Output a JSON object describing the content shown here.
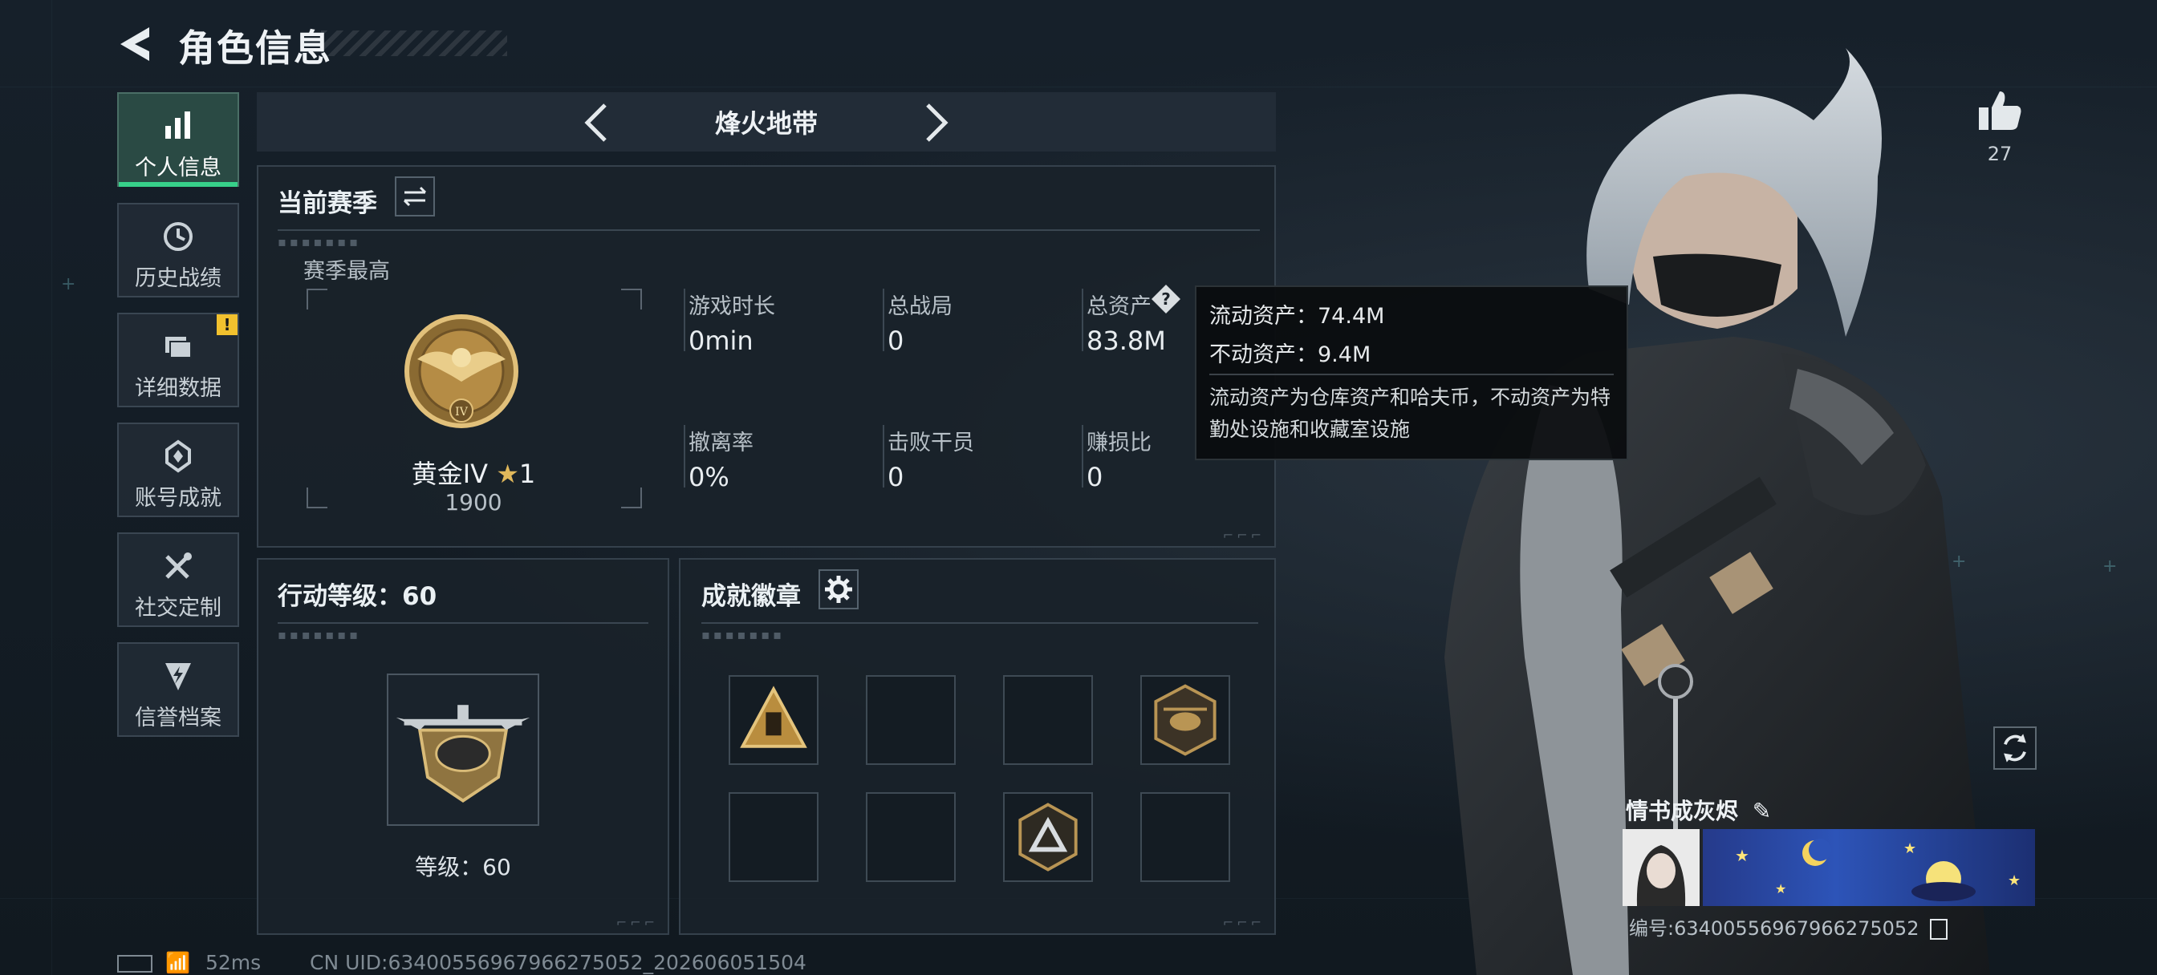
{
  "header": {
    "title": "角色信息",
    "back_icon": "back-arrow-icon"
  },
  "sidebar": {
    "items": [
      {
        "label": "个人信息",
        "icon": "bar-chart-icon",
        "active": true
      },
      {
        "label": "历史战绩",
        "icon": "history-clock-icon"
      },
      {
        "label": "详细数据",
        "icon": "folder-icon",
        "badge": "!"
      },
      {
        "label": "账号成就",
        "icon": "achievement-icon"
      },
      {
        "label": "社交定制",
        "icon": "tools-icon"
      },
      {
        "label": "信誉档案",
        "icon": "shield-bolt-icon"
      }
    ]
  },
  "map_selector": {
    "name": "烽火地带"
  },
  "season": {
    "title": "当前赛季",
    "peak_label": "赛季最高",
    "rank_name": "黄金IV",
    "rank_stars": "1",
    "rank_points": "1900",
    "stats": [
      {
        "label": "游戏时长",
        "value": "0min"
      },
      {
        "label": "总战局",
        "value": "0"
      },
      {
        "label": "总资产",
        "value": "83.8M"
      },
      {
        "label": "撤离率",
        "value": "0%"
      },
      {
        "label": "击败干员",
        "value": "0"
      },
      {
        "label": "赚损比",
        "value": "0"
      }
    ]
  },
  "tooltip": {
    "liquid": "流动资产：74.4M",
    "fixed": "不动资产：9.4M",
    "desc": "流动资产为仓库资产和哈夫币，不动资产为特勤处设施和收藏室设施"
  },
  "level": {
    "title": "行动等级：60",
    "caption": "等级：60"
  },
  "achievements": {
    "title": "成就徽章"
  },
  "profile": {
    "likes": "27",
    "name": "情书成灰烬",
    "id": "编号:63400556967966275052"
  },
  "status_bar": {
    "ping": "52ms",
    "uid": "CN UID:63400556967966275052_202606051504"
  },
  "colors": {
    "accent_green": "#37d08a",
    "gold": "#c9a45a",
    "warning": "#f2c12e"
  }
}
